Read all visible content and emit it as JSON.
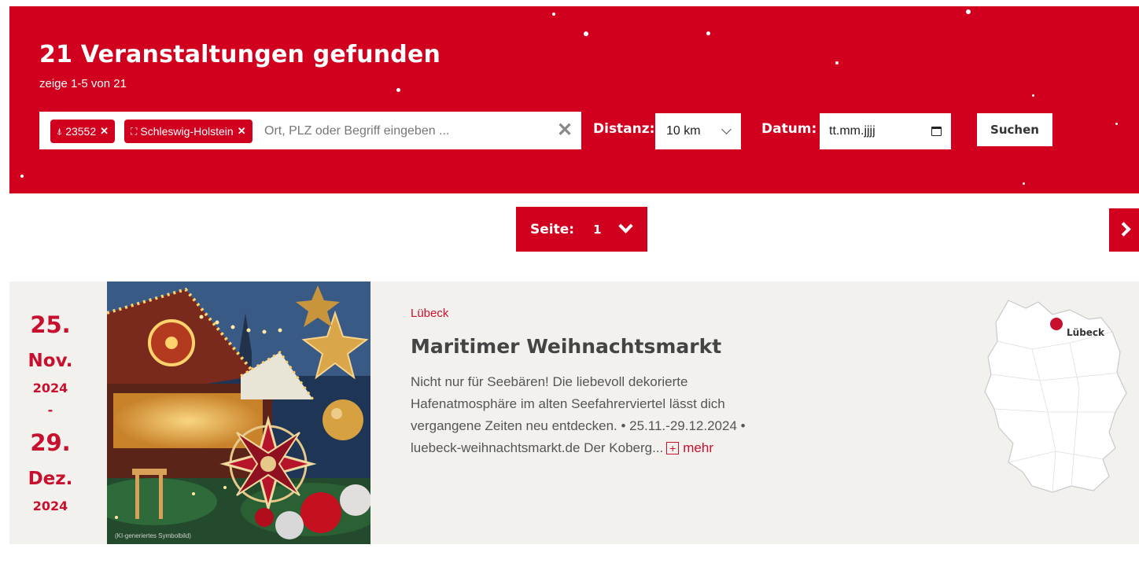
{
  "header": {
    "title": "21 Veranstaltungen gefunden",
    "subtitle": "zeige 1-5 von 21"
  },
  "search": {
    "chips": [
      {
        "icon": "location-pin-icon",
        "label": "23552"
      },
      {
        "icon": "region-map-icon",
        "label": "Schleswig-Holstein"
      }
    ],
    "placeholder": "Ort, PLZ oder Begriff eingeben ...",
    "distance_label": "Distanz:",
    "distance_value": "10 km",
    "date_label": "Datum:",
    "date_value": "tt.mm.jjjj",
    "search_button": "Suchen"
  },
  "pagination": {
    "label": "Seite:",
    "current": "1"
  },
  "event": {
    "start_day": "25.",
    "start_month": "Nov.",
    "start_year": "2024",
    "separator": "-",
    "end_day": "29.",
    "end_month": "Dez.",
    "end_year": "2024",
    "image_credit": "(KI-generiertes Symbolbild)",
    "location": "Lübeck",
    "title": "Maritimer Weihnachtsmarkt",
    "description": "Nicht nur für Seebären! Die liebevoll dekorierte Hafenatmosphäre im alten Seefahrerviertel lässt dich vergangene Zeiten neu entdecken. • 25.11.-29.12.2024 • luebeck-weihnachtsmarkt.de Der Koberg...",
    "more_label": "mehr",
    "map_label": "Lübeck"
  },
  "colors": {
    "brand_red": "#d0001e",
    "card_bg": "#f2f1ee"
  }
}
